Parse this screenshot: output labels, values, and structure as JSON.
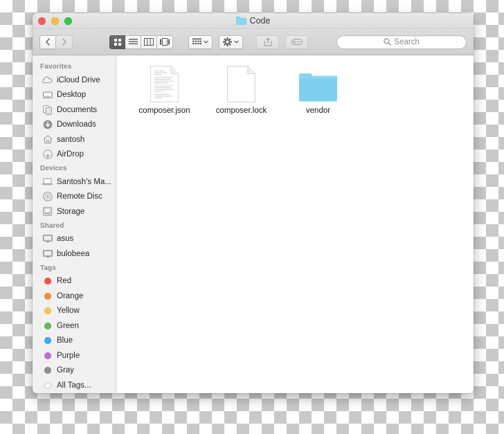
{
  "window": {
    "title": "Code",
    "title_icon": "folder-icon"
  },
  "traffic_lights": [
    {
      "name": "close-button",
      "color": "#fc5c54"
    },
    {
      "name": "minimize-button",
      "color": "#fdbc40"
    },
    {
      "name": "maximize-button",
      "color": "#34c749"
    }
  ],
  "toolbar": {
    "back_label": "Back",
    "forward_label": "Forward",
    "view_icon_label": "Icon view",
    "view_list_label": "List view",
    "view_column_label": "Column view",
    "view_cover_label": "Cover Flow view",
    "arrange_label": "Arrange",
    "action_label": "Action",
    "share_label": "Share",
    "tags_label": "Edit Tags"
  },
  "search": {
    "placeholder": "Search",
    "value": "",
    "icon": "search-icon"
  },
  "sidebar": {
    "sections": [
      {
        "header": "Favorites",
        "items": [
          {
            "label": "iCloud Drive",
            "icon": "icloud-icon"
          },
          {
            "label": "Desktop",
            "icon": "desktop-icon"
          },
          {
            "label": "Documents",
            "icon": "documents-icon"
          },
          {
            "label": "Downloads",
            "icon": "downloads-icon"
          },
          {
            "label": "santosh",
            "icon": "home-icon"
          },
          {
            "label": "AirDrop",
            "icon": "airdrop-icon"
          }
        ]
      },
      {
        "header": "Devices",
        "items": [
          {
            "label": "Santosh's Ma...",
            "icon": "laptop-icon"
          },
          {
            "label": "Remote Disc",
            "icon": "disc-icon"
          },
          {
            "label": "Storage",
            "icon": "drive-icon"
          }
        ]
      },
      {
        "header": "Shared",
        "items": [
          {
            "label": "asus",
            "icon": "monitor-icon"
          },
          {
            "label": "bulobeea",
            "icon": "monitor-icon"
          }
        ]
      },
      {
        "header": "Tags",
        "items": [
          {
            "label": "Red",
            "icon": "tag-dot-icon",
            "color": "#f6534f"
          },
          {
            "label": "Orange",
            "icon": "tag-dot-icon",
            "color": "#f5912e"
          },
          {
            "label": "Yellow",
            "icon": "tag-dot-icon",
            "color": "#f6c944"
          },
          {
            "label": "Green",
            "icon": "tag-dot-icon",
            "color": "#5cc04b"
          },
          {
            "label": "Blue",
            "icon": "tag-dot-icon",
            "color": "#35aff4"
          },
          {
            "label": "Purple",
            "icon": "tag-dot-icon",
            "color": "#c26ce0"
          },
          {
            "label": "Gray",
            "icon": "tag-dot-icon",
            "color": "#8e8e93"
          },
          {
            "label": "All Tags...",
            "icon": "tag-outline-icon",
            "color": "#ffffff"
          }
        ]
      }
    ]
  },
  "files": [
    {
      "name": "composer.json",
      "icon": "text-document-icon"
    },
    {
      "name": "composer.lock",
      "icon": "blank-document-icon"
    },
    {
      "name": "vendor",
      "icon": "folder-icon"
    }
  ]
}
